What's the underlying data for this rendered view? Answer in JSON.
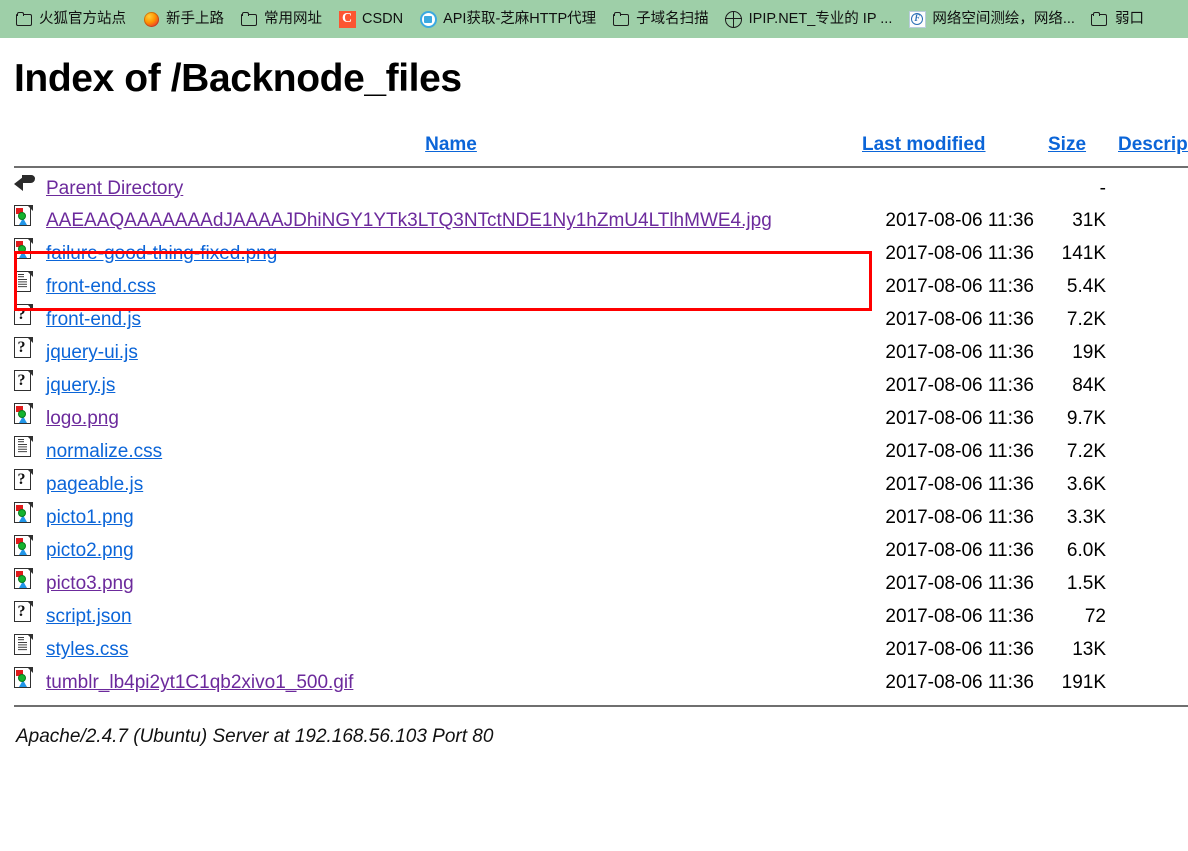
{
  "browser": {
    "bookmarks_bar": {
      "items": [
        {
          "label": "火狐官方站点",
          "icon": "folder-icon"
        },
        {
          "label": "新手上路",
          "icon": "firefox-icon"
        },
        {
          "label": "常用网址",
          "icon": "folder-icon"
        },
        {
          "label": "CSDN",
          "icon": "csdn-icon"
        },
        {
          "label": "API获取-芝麻HTTP代理",
          "icon": "blue-circle-icon"
        },
        {
          "label": "子域名扫描",
          "icon": "folder-icon"
        },
        {
          "label": "IPIP.NET_专业的 IP ...",
          "icon": "globe-icon"
        },
        {
          "label": "网络空间测绘，网络...",
          "icon": "f-badge-icon"
        },
        {
          "label": "弱口",
          "icon": "folder-icon"
        }
      ]
    }
  },
  "page": {
    "title": "Index of /Backnode_files",
    "headers": {
      "name": "Name",
      "last_modified": "Last modified",
      "size": "Size",
      "description": "Description"
    },
    "parent": {
      "name": "Parent Directory",
      "icon": "back-arrow-icon",
      "last_modified": "",
      "size": "-",
      "description": "",
      "visited": true
    },
    "rows": [
      {
        "name": "AAEAAQAAAAAAAdJAAAAJDhiNGY1YTk3LTQ3NTctNDE1Ny1hZmU4LTlhMWE4.jpg",
        "icon": "image-file-icon",
        "last_modified": "2017-08-06 11:36",
        "size": "31K",
        "description": "",
        "visited": true,
        "highlighted": true
      },
      {
        "name": "failure-good-thing-fixed.png",
        "icon": "image-file-icon",
        "last_modified": "2017-08-06 11:36",
        "size": "141K",
        "description": "",
        "visited": false
      },
      {
        "name": "front-end.css",
        "icon": "text-file-icon",
        "last_modified": "2017-08-06 11:36",
        "size": "5.4K",
        "description": "",
        "visited": false
      },
      {
        "name": "front-end.js",
        "icon": "unknown-file-icon",
        "last_modified": "2017-08-06 11:36",
        "size": "7.2K",
        "description": "",
        "visited": false
      },
      {
        "name": "jquery-ui.js",
        "icon": "unknown-file-icon",
        "last_modified": "2017-08-06 11:36",
        "size": "19K",
        "description": "",
        "visited": false
      },
      {
        "name": "jquery.js",
        "icon": "unknown-file-icon",
        "last_modified": "2017-08-06 11:36",
        "size": "84K",
        "description": "",
        "visited": false
      },
      {
        "name": "logo.png",
        "icon": "image-file-icon",
        "last_modified": "2017-08-06 11:36",
        "size": "9.7K",
        "description": "",
        "visited": true
      },
      {
        "name": "normalize.css",
        "icon": "text-file-icon",
        "last_modified": "2017-08-06 11:36",
        "size": "7.2K",
        "description": "",
        "visited": false
      },
      {
        "name": "pageable.js",
        "icon": "unknown-file-icon",
        "last_modified": "2017-08-06 11:36",
        "size": "3.6K",
        "description": "",
        "visited": false
      },
      {
        "name": "picto1.png",
        "icon": "image-file-icon",
        "last_modified": "2017-08-06 11:36",
        "size": "3.3K",
        "description": "",
        "visited": false
      },
      {
        "name": "picto2.png",
        "icon": "image-file-icon",
        "last_modified": "2017-08-06 11:36",
        "size": "6.0K",
        "description": "",
        "visited": false
      },
      {
        "name": "picto3.png",
        "icon": "image-file-icon",
        "last_modified": "2017-08-06 11:36",
        "size": "1.5K",
        "description": "",
        "visited": true
      },
      {
        "name": "script.json",
        "icon": "unknown-file-icon",
        "last_modified": "2017-08-06 11:36",
        "size": "72",
        "description": "",
        "visited": false
      },
      {
        "name": "styles.css",
        "icon": "text-file-icon",
        "last_modified": "2017-08-06 11:36",
        "size": "13K",
        "description": "",
        "visited": false
      },
      {
        "name": "tumblr_lb4pi2yt1C1qb2xivo1_500.gif",
        "icon": "image-file-icon",
        "last_modified": "2017-08-06 11:36",
        "size": "191K",
        "description": "",
        "visited": true
      }
    ],
    "footer": "Apache/2.4.7 (Ubuntu) Server at 192.168.56.103 Port 80"
  },
  "annotation": {
    "type": "rectangle",
    "color": "#ff0000"
  },
  "colors": {
    "bookmark_bar_bg": "#9ecfa8",
    "link": "#0b65d8",
    "link_visited": "#6c2a9c",
    "rule": "#6f6f6f",
    "annotation": "#ff0000"
  }
}
